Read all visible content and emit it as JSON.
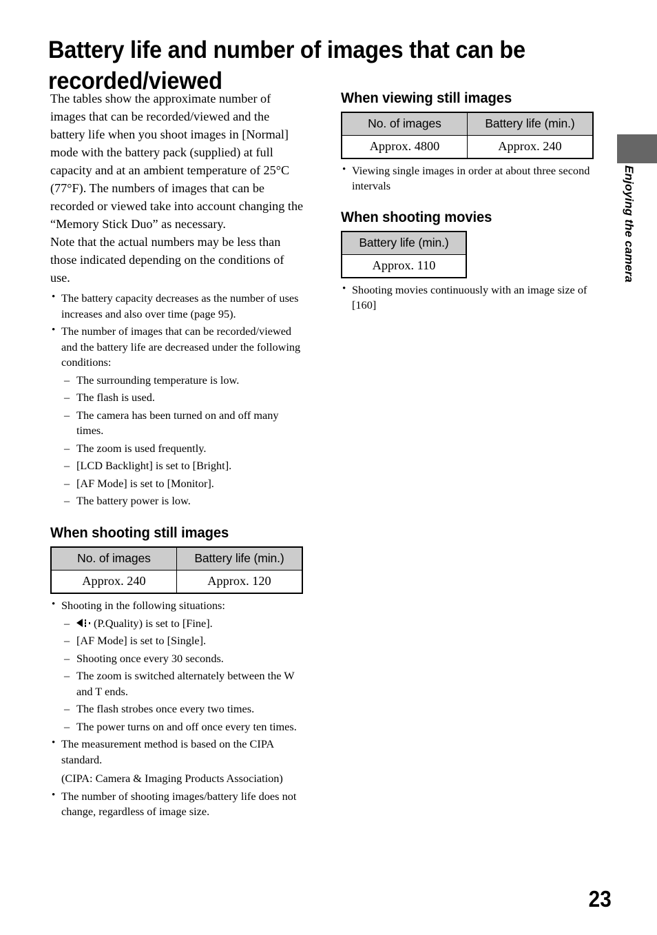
{
  "document": {
    "title": "Battery life and number of images that can be recorded/viewed",
    "page_number": "23",
    "side_tab_label": "Enjoying the camera",
    "side_tab_color": "#666666",
    "table_header_fill": "#cccccc"
  },
  "left_column": {
    "intro_paragraph_1": "The tables show the approximate number of images that can be recorded/viewed and the battery life when you shoot images in [Normal] mode with the battery pack (supplied) at full capacity and at an ambient temperature of 25°C (77°F). The numbers of images that can be recorded or viewed take into account changing the “Memory Stick Duo” as necessary.",
    "intro_paragraph_2": "Note that the actual numbers may be less than those indicated depending on the conditions of use.",
    "bullets": [
      "The battery capacity decreases as the number of uses increases and also over time (page 95).",
      "The number of images that can be recorded/viewed and the battery life are decreased under the following conditions:"
    ],
    "conditions": [
      "The surrounding temperature is low.",
      "The flash is used.",
      "The camera has been turned on and off many times.",
      "The zoom is used frequently.",
      "[LCD Backlight] is set to [Bright].",
      "[AF Mode] is set to [Monitor].",
      "The battery power is low."
    ],
    "section": {
      "heading": "When shooting still images",
      "table": {
        "columns": [
          "No. of images",
          "Battery life (min.)"
        ],
        "rows": [
          [
            "Approx. 240",
            "Approx. 120"
          ]
        ]
      },
      "notes_lead": "Shooting in the following situations:",
      "situations_icon_item": "(P.Quality) is set to [Fine].",
      "situations_icon_name": "picture-quality-icon",
      "situations": [
        "[AF Mode] is set to [Single].",
        "Shooting once every 30 seconds.",
        "The zoom is switched alternately between the W and T ends.",
        "The flash strobes once every two times.",
        "The power turns on and off once every ten times."
      ],
      "note_cipa": "The measurement method is based on the CIPA standard.",
      "note_cipa_expansion": "(CIPA: Camera & Imaging Products Association)",
      "note_size": "The number of shooting images/battery life does not change, regardless of image size."
    }
  },
  "right_column": {
    "viewing": {
      "heading": "When viewing still images",
      "table": {
        "columns": [
          "No. of images",
          "Battery life (min.)"
        ],
        "rows": [
          [
            "Approx. 4800",
            "Approx. 240"
          ]
        ]
      },
      "note": "Viewing single images in order at about three second intervals"
    },
    "movies": {
      "heading": "When shooting movies",
      "table": {
        "columns": [
          "Battery life (min.)"
        ],
        "rows": [
          [
            "Approx. 110"
          ]
        ]
      },
      "note": "Shooting movies continuously with an image size of [160]"
    }
  }
}
